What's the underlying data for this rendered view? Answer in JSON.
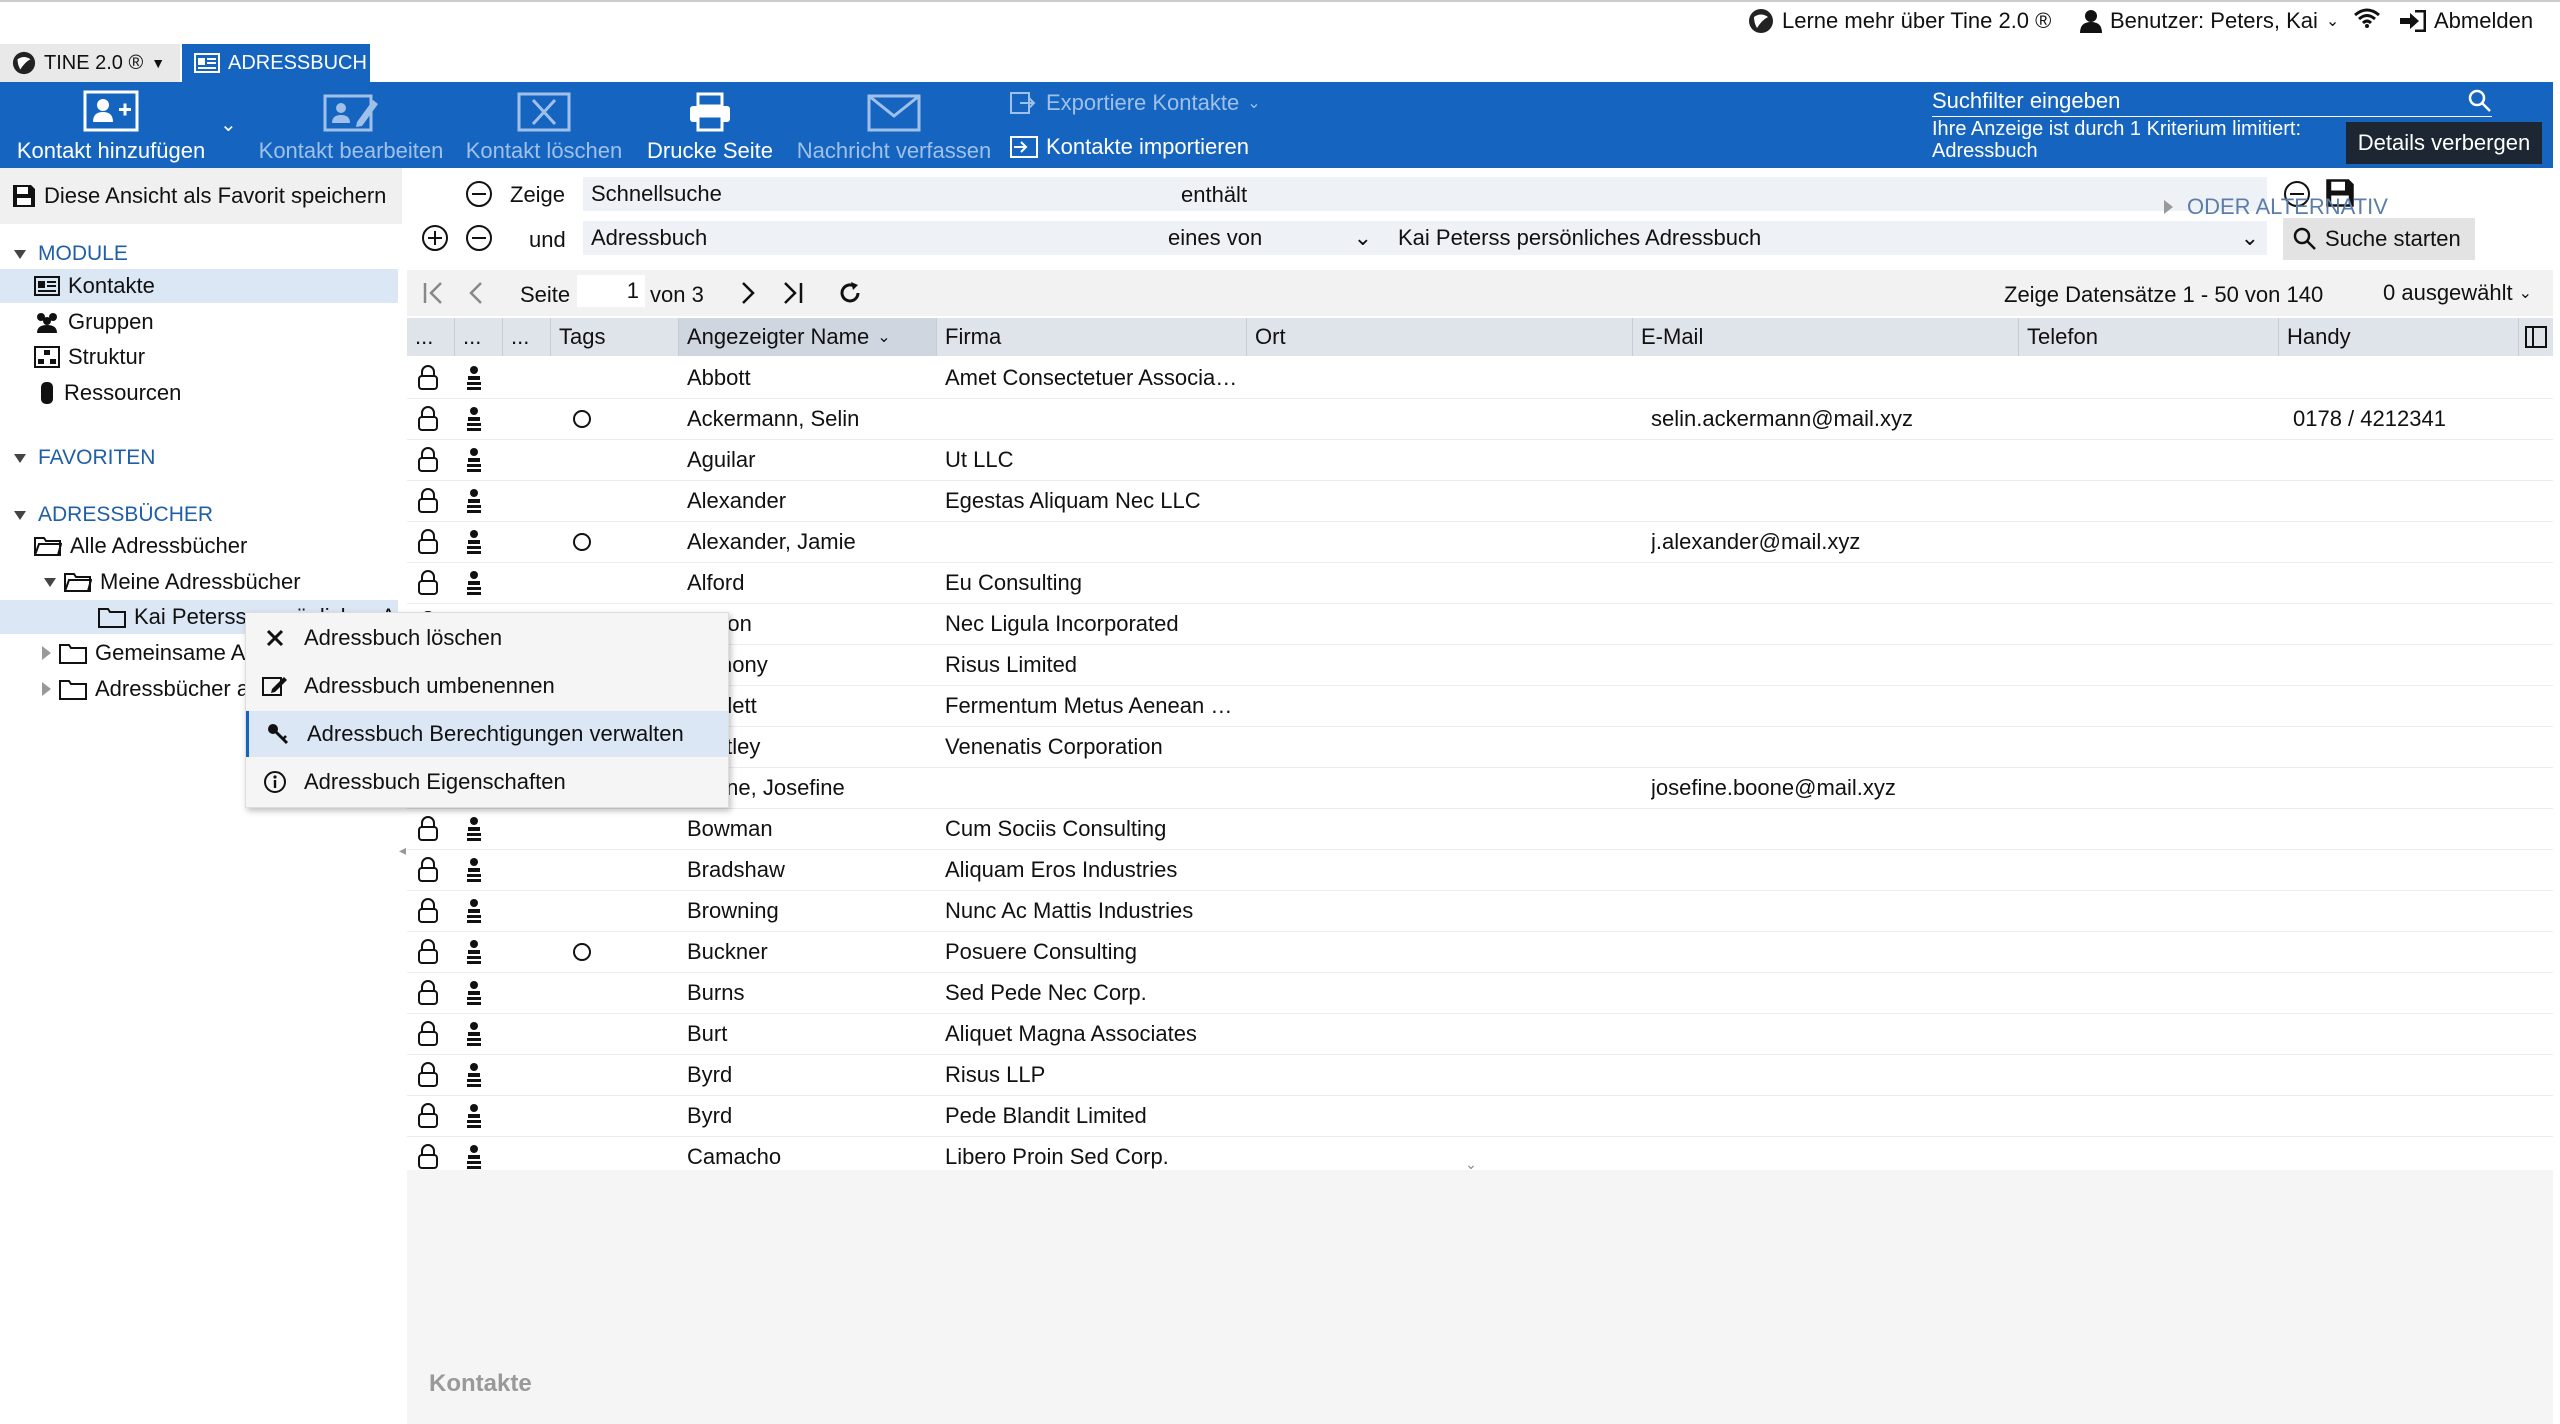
{
  "topbar": {
    "learn_more": "Lerne mehr über Tine 2.0 ®",
    "user": "Benutzer: Peters, Kai",
    "logout": "Abmelden"
  },
  "apptabs": {
    "tine": "TINE 2.0 ®",
    "addressbook": "ADRESSBUCH"
  },
  "toolbar": {
    "add_contact": "Kontakt hinzufügen",
    "edit_contact": "Kontakt bearbeiten",
    "delete_contact": "Kontakt löschen",
    "print_page": "Drucke Seite",
    "compose_message": "Nachricht verfassen",
    "export_contacts": "Exportiere Kontakte",
    "import_contacts": "Kontakte importieren",
    "search_placeholder": "Suchfilter eingeben",
    "filter_note_line1": "Ihre Anzeige ist durch 1 Kriterium limitiert:",
    "filter_note_line2": "Adressbuch",
    "hide_details": "Details verbergen"
  },
  "left": {
    "save_favorite": "Diese Ansicht als Favorit speichern",
    "modules_title": "MODULE",
    "modules": [
      "Kontakte",
      "Gruppen",
      "Struktur",
      "Ressourcen"
    ],
    "favorites_title": "FAVORITEN",
    "addressbooks_title": "ADRESSBÜCHER",
    "all_addressbooks": "Alle Adressbücher",
    "my_addressbooks": "Meine Adressbücher",
    "kai_book": "Kai Peterss persönliches A",
    "shared": "Gemeinsame Adressbücher",
    "others": "Adressbücher anderer Benutzer"
  },
  "filter": {
    "show": "Zeige",
    "quicksearch": "Schnellsuche",
    "contains": "enthält",
    "and": "und",
    "addressbook": "Adressbuch",
    "one_of": "eines von",
    "book_value": "Kai Peterss persönliches Adressbuch",
    "search_button": "Suche starten",
    "or_alternative": "ODER ALTERNATIV"
  },
  "pager": {
    "page_label": "Seite",
    "page_value": "1",
    "of_label": "von 3",
    "records": "Zeige Datensätze 1 - 50 von 140",
    "selected": "0 ausgewählt"
  },
  "columns": {
    "c1": "...",
    "c2": "...",
    "c3": "...",
    "tags": "Tags",
    "name": "Angezeigter Name",
    "company": "Firma",
    "city": "Ort",
    "email": "E-Mail",
    "phone": "Telefon",
    "mobile": "Handy"
  },
  "rows": [
    {
      "name": "Abbott",
      "company": "Amet Consectetuer Associa…",
      "email": "",
      "mobile": "",
      "tag": false
    },
    {
      "name": "Ackermann, Selin",
      "company": "",
      "email": "selin.ackermann@mail.xyz",
      "mobile": "0178 / 4212341",
      "tag": true
    },
    {
      "name": "Aguilar",
      "company": "Ut LLC",
      "email": "",
      "mobile": "",
      "tag": false
    },
    {
      "name": "Alexander",
      "company": "Egestas Aliquam Nec LLC",
      "email": "",
      "mobile": "",
      "tag": false
    },
    {
      "name": "Alexander, Jamie",
      "company": "",
      "email": "j.alexander@mail.xyz",
      "mobile": "",
      "tag": true
    },
    {
      "name": "Alford",
      "company": "Eu Consulting",
      "email": "",
      "mobile": "",
      "tag": false
    },
    {
      "name": "Allison",
      "company": "Nec Ligula Incorporated",
      "email": "",
      "mobile": "",
      "tag": false
    },
    {
      "name": "Anthony",
      "company": "Risus Limited",
      "email": "",
      "mobile": "",
      "tag": false
    },
    {
      "name": "Bartlett",
      "company": "Fermentum Metus Aenean …",
      "email": "",
      "mobile": "",
      "tag": false
    },
    {
      "name": "Bentley",
      "company": "Venenatis Corporation",
      "email": "",
      "mobile": "",
      "tag": false
    },
    {
      "name": "Boone, Josefine",
      "company": "",
      "email": "josefine.boone@mail.xyz",
      "mobile": "",
      "tag": false
    },
    {
      "name": "Bowman",
      "company": "Cum Sociis Consulting",
      "email": "",
      "mobile": "",
      "tag": false
    },
    {
      "name": "Bradshaw",
      "company": "Aliquam Eros Industries",
      "email": "",
      "mobile": "",
      "tag": false
    },
    {
      "name": "Browning",
      "company": "Nunc Ac Mattis Industries",
      "email": "",
      "mobile": "",
      "tag": false
    },
    {
      "name": "Buckner",
      "company": "Posuere Consulting",
      "email": "",
      "mobile": "",
      "tag": true
    },
    {
      "name": "Burns",
      "company": "Sed Pede Nec Corp.",
      "email": "",
      "mobile": "",
      "tag": false
    },
    {
      "name": "Burt",
      "company": "Aliquet Magna Associates",
      "email": "",
      "mobile": "",
      "tag": false
    },
    {
      "name": "Byrd",
      "company": "Risus LLP",
      "email": "",
      "mobile": "",
      "tag": false
    },
    {
      "name": "Byrd",
      "company": "Pede Blandit Limited",
      "email": "",
      "mobile": "",
      "tag": false
    },
    {
      "name": "Camacho",
      "company": "Libero Proin Sed Corp.",
      "email": "",
      "mobile": "",
      "tag": false
    }
  ],
  "context_menu": {
    "delete": "Adressbuch löschen",
    "rename": "Adressbuch umbenennen",
    "permissions": "Adressbuch Berechtigungen verwalten",
    "properties": "Adressbuch Eigenschaften"
  },
  "details": {
    "title": "Kontakte"
  },
  "colors": {
    "toolbar": "#1565c0",
    "link": "#1f5fa8",
    "selected": "#dbe7f5",
    "hover": "#e3edf8"
  }
}
